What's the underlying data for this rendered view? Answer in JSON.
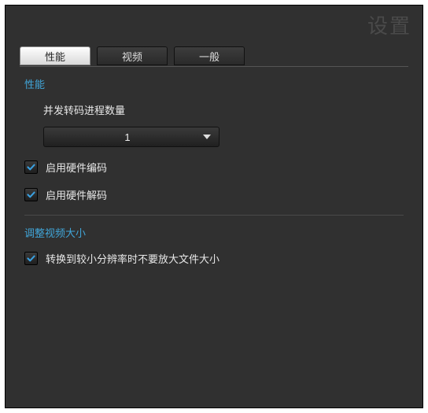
{
  "title_ghost": "设置",
  "tabs": {
    "performance": "性能",
    "video": "视频",
    "general": "一般"
  },
  "active_tab": "performance",
  "section_performance": {
    "header": "性能",
    "concurrent_label": "并发转码进程数量",
    "concurrent_value": "1",
    "hw_encode_label": "启用硬件编码",
    "hw_encode_checked": true,
    "hw_decode_label": "启用硬件解码",
    "hw_decode_checked": true
  },
  "section_resize": {
    "header": "调整视频大小",
    "no_upscale_label": "转换到较小分辨率时不要放大文件大小",
    "no_upscale_checked": true
  }
}
